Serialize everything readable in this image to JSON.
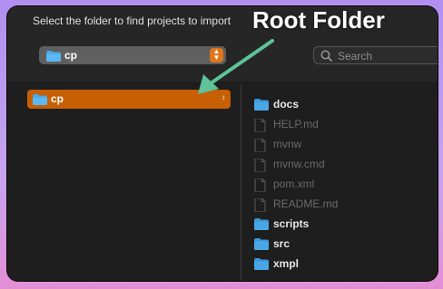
{
  "dialog": {
    "title": "Select the folder to find projects to import",
    "location": "cp",
    "search_placeholder": "Search"
  },
  "annotation": {
    "text": "Root Folder",
    "color": "#5ec29a"
  },
  "sidebar": {
    "selected": "cp"
  },
  "files": [
    {
      "name": "docs",
      "type": "folder"
    },
    {
      "name": "HELP.md",
      "type": "file"
    },
    {
      "name": "mvnw",
      "type": "file"
    },
    {
      "name": "mvnw.cmd",
      "type": "file"
    },
    {
      "name": "pom.xml",
      "type": "file"
    },
    {
      "name": "README.md",
      "type": "file"
    },
    {
      "name": "scripts",
      "type": "folder"
    },
    {
      "name": "src",
      "type": "folder"
    },
    {
      "name": "xmpl",
      "type": "folder"
    }
  ],
  "colors": {
    "accent": "#e0761c",
    "selection": "#c75f05",
    "folder": "#49a8e8"
  }
}
